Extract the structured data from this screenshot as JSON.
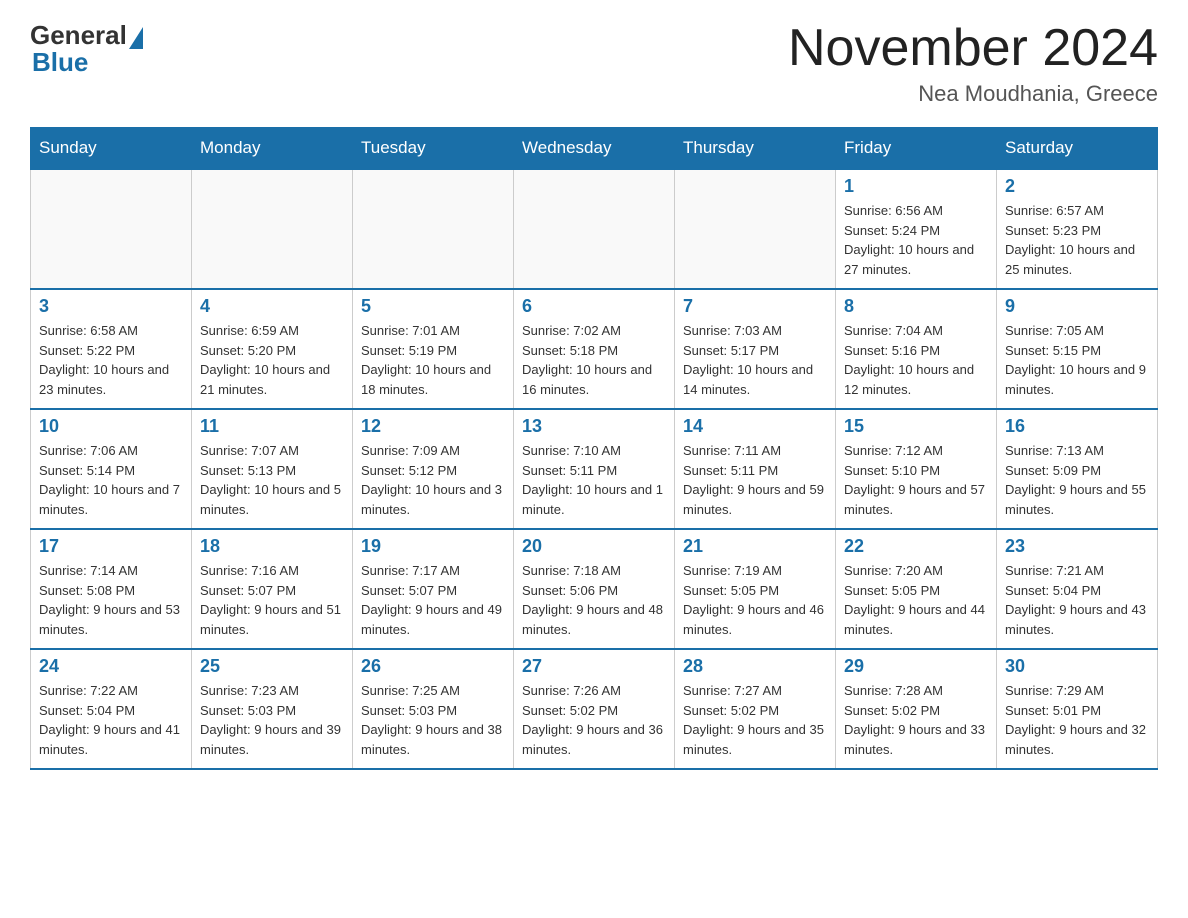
{
  "logo": {
    "general": "General",
    "blue": "Blue"
  },
  "header": {
    "month_year": "November 2024",
    "location": "Nea Moudhania, Greece"
  },
  "days_of_week": [
    "Sunday",
    "Monday",
    "Tuesday",
    "Wednesday",
    "Thursday",
    "Friday",
    "Saturday"
  ],
  "weeks": [
    [
      {
        "day": "",
        "info": ""
      },
      {
        "day": "",
        "info": ""
      },
      {
        "day": "",
        "info": ""
      },
      {
        "day": "",
        "info": ""
      },
      {
        "day": "",
        "info": ""
      },
      {
        "day": "1",
        "info": "Sunrise: 6:56 AM\nSunset: 5:24 PM\nDaylight: 10 hours and 27 minutes."
      },
      {
        "day": "2",
        "info": "Sunrise: 6:57 AM\nSunset: 5:23 PM\nDaylight: 10 hours and 25 minutes."
      }
    ],
    [
      {
        "day": "3",
        "info": "Sunrise: 6:58 AM\nSunset: 5:22 PM\nDaylight: 10 hours and 23 minutes."
      },
      {
        "day": "4",
        "info": "Sunrise: 6:59 AM\nSunset: 5:20 PM\nDaylight: 10 hours and 21 minutes."
      },
      {
        "day": "5",
        "info": "Sunrise: 7:01 AM\nSunset: 5:19 PM\nDaylight: 10 hours and 18 minutes."
      },
      {
        "day": "6",
        "info": "Sunrise: 7:02 AM\nSunset: 5:18 PM\nDaylight: 10 hours and 16 minutes."
      },
      {
        "day": "7",
        "info": "Sunrise: 7:03 AM\nSunset: 5:17 PM\nDaylight: 10 hours and 14 minutes."
      },
      {
        "day": "8",
        "info": "Sunrise: 7:04 AM\nSunset: 5:16 PM\nDaylight: 10 hours and 12 minutes."
      },
      {
        "day": "9",
        "info": "Sunrise: 7:05 AM\nSunset: 5:15 PM\nDaylight: 10 hours and 9 minutes."
      }
    ],
    [
      {
        "day": "10",
        "info": "Sunrise: 7:06 AM\nSunset: 5:14 PM\nDaylight: 10 hours and 7 minutes."
      },
      {
        "day": "11",
        "info": "Sunrise: 7:07 AM\nSunset: 5:13 PM\nDaylight: 10 hours and 5 minutes."
      },
      {
        "day": "12",
        "info": "Sunrise: 7:09 AM\nSunset: 5:12 PM\nDaylight: 10 hours and 3 minutes."
      },
      {
        "day": "13",
        "info": "Sunrise: 7:10 AM\nSunset: 5:11 PM\nDaylight: 10 hours and 1 minute."
      },
      {
        "day": "14",
        "info": "Sunrise: 7:11 AM\nSunset: 5:11 PM\nDaylight: 9 hours and 59 minutes."
      },
      {
        "day": "15",
        "info": "Sunrise: 7:12 AM\nSunset: 5:10 PM\nDaylight: 9 hours and 57 minutes."
      },
      {
        "day": "16",
        "info": "Sunrise: 7:13 AM\nSunset: 5:09 PM\nDaylight: 9 hours and 55 minutes."
      }
    ],
    [
      {
        "day": "17",
        "info": "Sunrise: 7:14 AM\nSunset: 5:08 PM\nDaylight: 9 hours and 53 minutes."
      },
      {
        "day": "18",
        "info": "Sunrise: 7:16 AM\nSunset: 5:07 PM\nDaylight: 9 hours and 51 minutes."
      },
      {
        "day": "19",
        "info": "Sunrise: 7:17 AM\nSunset: 5:07 PM\nDaylight: 9 hours and 49 minutes."
      },
      {
        "day": "20",
        "info": "Sunrise: 7:18 AM\nSunset: 5:06 PM\nDaylight: 9 hours and 48 minutes."
      },
      {
        "day": "21",
        "info": "Sunrise: 7:19 AM\nSunset: 5:05 PM\nDaylight: 9 hours and 46 minutes."
      },
      {
        "day": "22",
        "info": "Sunrise: 7:20 AM\nSunset: 5:05 PM\nDaylight: 9 hours and 44 minutes."
      },
      {
        "day": "23",
        "info": "Sunrise: 7:21 AM\nSunset: 5:04 PM\nDaylight: 9 hours and 43 minutes."
      }
    ],
    [
      {
        "day": "24",
        "info": "Sunrise: 7:22 AM\nSunset: 5:04 PM\nDaylight: 9 hours and 41 minutes."
      },
      {
        "day": "25",
        "info": "Sunrise: 7:23 AM\nSunset: 5:03 PM\nDaylight: 9 hours and 39 minutes."
      },
      {
        "day": "26",
        "info": "Sunrise: 7:25 AM\nSunset: 5:03 PM\nDaylight: 9 hours and 38 minutes."
      },
      {
        "day": "27",
        "info": "Sunrise: 7:26 AM\nSunset: 5:02 PM\nDaylight: 9 hours and 36 minutes."
      },
      {
        "day": "28",
        "info": "Sunrise: 7:27 AM\nSunset: 5:02 PM\nDaylight: 9 hours and 35 minutes."
      },
      {
        "day": "29",
        "info": "Sunrise: 7:28 AM\nSunset: 5:02 PM\nDaylight: 9 hours and 33 minutes."
      },
      {
        "day": "30",
        "info": "Sunrise: 7:29 AM\nSunset: 5:01 PM\nDaylight: 9 hours and 32 minutes."
      }
    ]
  ]
}
